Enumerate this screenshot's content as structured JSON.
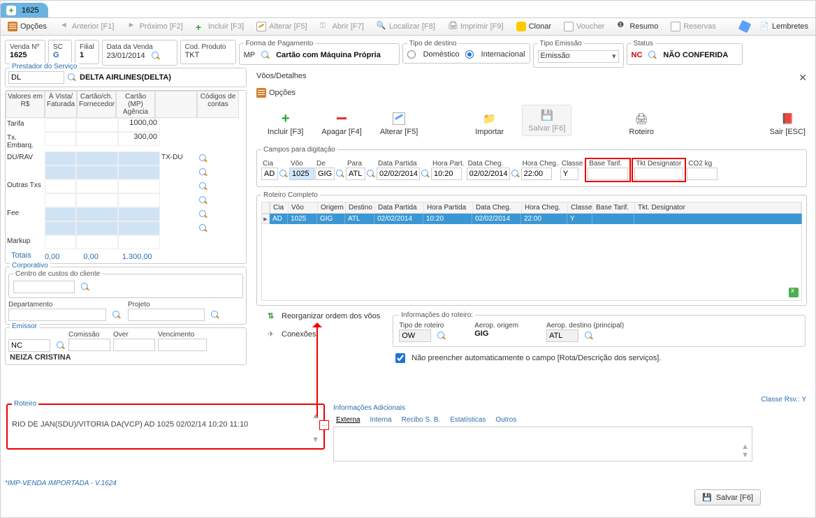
{
  "tab": {
    "label": "1625"
  },
  "toolbar": {
    "opcoes": "Opções",
    "anterior": "Anterior [F1]",
    "proximo": "Próximo [F2]",
    "incluir": "Incluir [F3]",
    "alterar": "Alterar [F5]",
    "abrir": "Abrir [F7]",
    "localizar": "Localizar [F8]",
    "imprimir": "Imprimir [F9]",
    "clonar": "Clonar",
    "voucher": "Voucher",
    "resumo": "Resumo",
    "reservas": "Reservas",
    "lembretes": "Lembretes"
  },
  "header": {
    "venda_lbl": "Venda Nº",
    "venda": "1625",
    "sc_lbl": "SC",
    "sc": "G",
    "filial_lbl": "Filial",
    "filial": "1",
    "data_lbl": "Data da Venda",
    "data": "23/01/2014",
    "cod_lbl": "Cod. Produto",
    "cod": "TKT",
    "forma_lbl": "Forma de Pagamento",
    "mp": "MP",
    "forma": "Cartão com Máquina Própria",
    "tipo_dest_lbl": "Tipo de destino",
    "dom": "Doméstico",
    "int": "Internacional",
    "tipo_emi_lbl": "Tipo Emissão",
    "tipo_emi": "Emissão",
    "status_lbl": "Status",
    "status_code": "NC",
    "status": "NÃO CONFERIDA"
  },
  "provider": {
    "title": "Prestador do Serviço",
    "code": "DL",
    "name": "DELTA AIRLINES(DELTA)"
  },
  "values": {
    "h1": "Valores em R$",
    "h2": "À Vista/ Faturada",
    "h3": "Cartão/ch. Fornecedor",
    "h4": "Cartão (MP) Agência",
    "h5": "",
    "h6": "Códigos de contas",
    "tarifa_lbl": "Tarifa",
    "tarifa_mp": "1000,00",
    "txemb_lbl": "Tx. Embarq.",
    "txemb_mp": "300,00",
    "durav_lbl": "DU/RAV",
    "durav_code": "TX-DU",
    "outras_lbl": "Outras Txs",
    "fee_lbl": "Fee",
    "markup_lbl": "Markup",
    "totais_lbl": "Totais",
    "t1": "0,00",
    "t2": "0,00",
    "t3": "1.300,00"
  },
  "corp": {
    "title": "Corporativo",
    "centro_lbl": "Centro de custos do cliente",
    "dep_lbl": "Departamento",
    "proj_lbl": "Projeto"
  },
  "emissor": {
    "title": "Emissor",
    "code": "NC",
    "com_lbl": "Comissão",
    "over_lbl": "Over",
    "venc_lbl": "Vencimento",
    "name": "NEIZA CRISTINA"
  },
  "voos": {
    "title": "Vôos/Detalhes",
    "opcoes": "Opções",
    "incluir": "Incluir [F3]",
    "apagar": "Apagar [F4]",
    "alterar": "Alterar [F5]",
    "importar": "Importar",
    "salvar": "Salvar [F6]",
    "roteiro_btn": "Roteiro",
    "sair": "Sair [ESC]",
    "campos_lbl": "Campos para digitação",
    "cols": {
      "cia": "Cia",
      "voo": "Vôo",
      "de": "De",
      "para": "Para",
      "dp": "Data Partida",
      "hp": "Hora Part.",
      "dc": "Data Cheg.",
      "hc": "Hora Cheg.",
      "cl": "Classe",
      "bt": "Base Tarif.",
      "td": "Tkt Designator",
      "co2": "CO2 kg"
    },
    "vals": {
      "cia": "AD",
      "voo": "1025",
      "de": "GIG",
      "para": "ATL",
      "dp": "02/02/2014",
      "hp": "10:20",
      "dc": "02/02/2014",
      "hc": "22:00",
      "cl": "Y"
    },
    "roteiro_lbl": "Roteiro Completo",
    "rcols": {
      "cia": "Cia",
      "voo": "Vôo",
      "org": "Origem",
      "dst": "Destino",
      "dp": "Data Partida",
      "hp": "Hora Partida",
      "dc": "Data Cheg.",
      "hc": "Hora Cheg.",
      "cl": "Classe",
      "bt": "Base Tarif.",
      "td": "Tkt. Designator"
    },
    "rrow": {
      "cia": "AD",
      "voo": "1025",
      "org": "GIG",
      "dst": "ATL",
      "dp": "02/02/2014",
      "hp": "10:20",
      "dc": "02/02/2014",
      "hc": "22:00",
      "cl": "Y"
    },
    "reorg": "Reorganizar ordem dos vôos",
    "conex": "Conexões",
    "info": {
      "title": "Informações do roteiro:",
      "tipo_lbl": "Tipo de roteiro",
      "tipo": "OW",
      "ao_lbl": "Aerop. origem",
      "ao": "GIG",
      "ad_lbl": "Aerop. destino (principal)",
      "ad": "ATL",
      "chk": "Não preencher automaticamente o campo [Rota/Descrição dos serviços]."
    }
  },
  "roteiro": {
    "title": "Roteiro",
    "class": "Classe Rsv.: Y",
    "text": "RIO DE JAN(SDU)/VITORIA DA(VCP) AD 1025 02/02/14 10:20 11:10"
  },
  "footer_note": "*IMP-VENDA IMPORTADA - V.1624",
  "info_adic": {
    "title": "Informações Adicionais",
    "t1": "Externa",
    "t2": "Interna",
    "t3": "Recibo S. B.",
    "t4": "Estatísticas",
    "t5": "Outros"
  },
  "save_btn": "Salvar [F6]"
}
